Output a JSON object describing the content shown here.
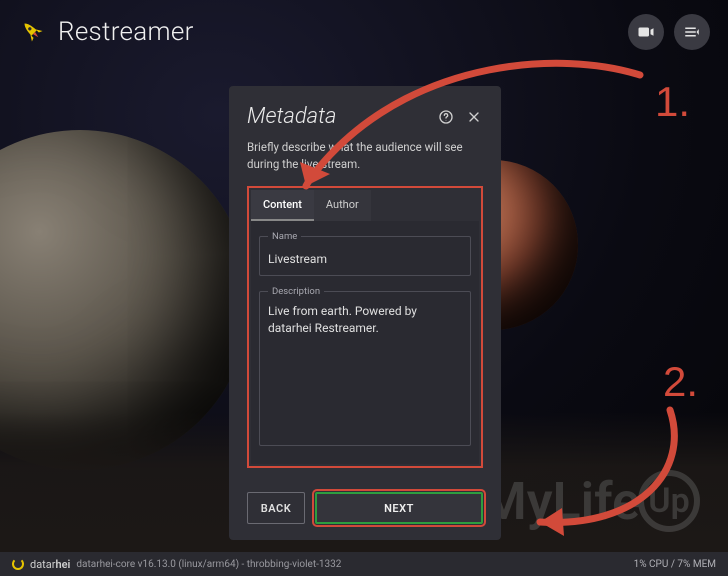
{
  "brand": "Restreamer",
  "modal": {
    "title": "Metadata",
    "description": "Briefly describe what the audience will see during the live stream.",
    "tabs": {
      "content": "Content",
      "author": "Author"
    },
    "fields": {
      "name_label": "Name",
      "name_value": "Livestream",
      "desc_label": "Description",
      "desc_value": "Live from earth. Powered by datarhei Restreamer."
    },
    "buttons": {
      "back": "BACK",
      "next": "NEXT"
    }
  },
  "annotations": {
    "step1": "1.",
    "step2": "2."
  },
  "watermark": {
    "left": "PiMyLife",
    "circle": "Up"
  },
  "status": {
    "brand_light": "datar",
    "brand_bold": "hei",
    "text": "datarhei-core v16.13.0 (linux/arm64) - throbbing-violet-1332",
    "right": "1% CPU / 7% MEM"
  }
}
